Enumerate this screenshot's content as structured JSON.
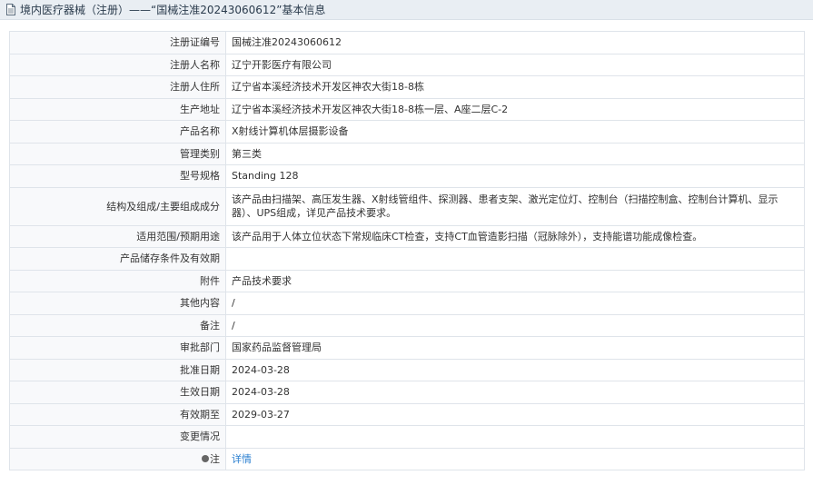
{
  "header": {
    "title": "境内医疗器械（注册）——“国械注准20243060612”基本信息"
  },
  "rows": [
    {
      "label": "注册证编号",
      "value": "国械注准20243060612"
    },
    {
      "label": "注册人名称",
      "value": "辽宁开影医疗有限公司"
    },
    {
      "label": "注册人住所",
      "value": "辽宁省本溪经济技术开发区神农大街18-8栋"
    },
    {
      "label": "生产地址",
      "value": "辽宁省本溪经济技术开发区神农大街18-8栋一层、A座二层C-2"
    },
    {
      "label": "产品名称",
      "value": "X射线计算机体层摄影设备"
    },
    {
      "label": "管理类别",
      "value": "第三类"
    },
    {
      "label": "型号规格",
      "value": "Standing 128"
    },
    {
      "label": "结构及组成/主要组成成分",
      "value": "该产品由扫描架、高压发生器、X射线管组件、探测器、患者支架、激光定位灯、控制台（扫描控制盒、控制台计算机、显示器）、UPS组成，详见产品技术要求。"
    },
    {
      "label": "适用范围/预期用途",
      "value": "该产品用于人体立位状态下常规临床CT检查，支持CT血管造影扫描（冠脉除外），支持能谱功能成像检查。"
    },
    {
      "label": "产品储存条件及有效期",
      "value": ""
    },
    {
      "label": "附件",
      "value": "产品技术要求"
    },
    {
      "label": "其他内容",
      "value": "/"
    },
    {
      "label": "备注",
      "value": "/"
    },
    {
      "label": "审批部门",
      "value": "国家药品监督管理局"
    },
    {
      "label": "批准日期",
      "value": "2024-03-28"
    },
    {
      "label": "生效日期",
      "value": "2024-03-28"
    },
    {
      "label": "有效期至",
      "value": "2029-03-27"
    },
    {
      "label": "变更情况",
      "value": ""
    },
    {
      "label": "注",
      "value": "详情"
    }
  ],
  "icons": {
    "header": "document-icon",
    "note": "note-icon"
  },
  "colors": {
    "link": "#2a7fd0",
    "header_bg": "#e9eef3"
  }
}
